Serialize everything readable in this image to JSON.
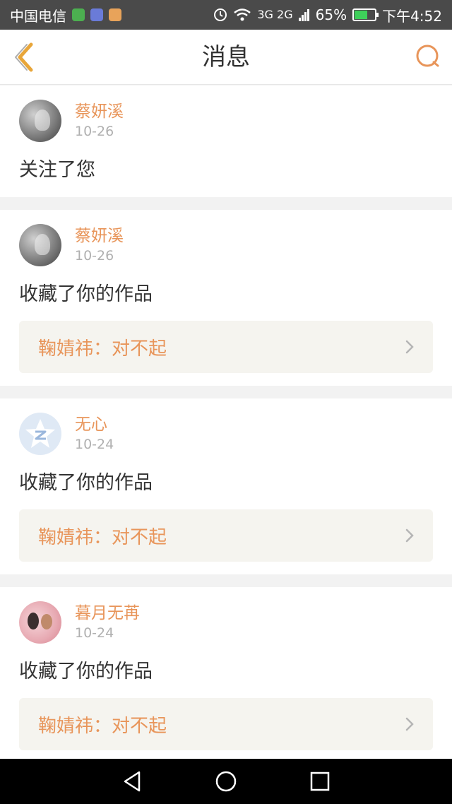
{
  "status_bar": {
    "carrier": "中国电信",
    "battery_percent": "65%",
    "battery_level": 0.65,
    "time": "下午4:52",
    "network": "3G 2G",
    "icons": [
      "sms-icon",
      "music-icon",
      "weibo-icon",
      "alarm-icon",
      "wifi-icon",
      "signal-icon",
      "battery-icon"
    ]
  },
  "header": {
    "title": "消息",
    "accent_color": "#e8955a"
  },
  "messages": [
    {
      "username": "蔡妍溪",
      "date": "10-26",
      "action": "关注了您",
      "avatar": "photo"
    },
    {
      "username": "蔡妍溪",
      "date": "10-26",
      "action": "收藏了你的作品",
      "work": "鞠婧祎：对不起",
      "avatar": "photo"
    },
    {
      "username": "无心",
      "date": "10-24",
      "action": "收藏了你的作品",
      "work": "鞠婧祎：对不起",
      "avatar": "qzone"
    },
    {
      "username": "暮月无苒",
      "date": "10-24",
      "action": "收藏了你的作品",
      "work": "鞠婧祎：对不起",
      "avatar": "couple-photo"
    }
  ],
  "nav": {
    "icons": [
      "back-triangle-icon",
      "home-circle-icon",
      "recents-square-icon"
    ]
  }
}
